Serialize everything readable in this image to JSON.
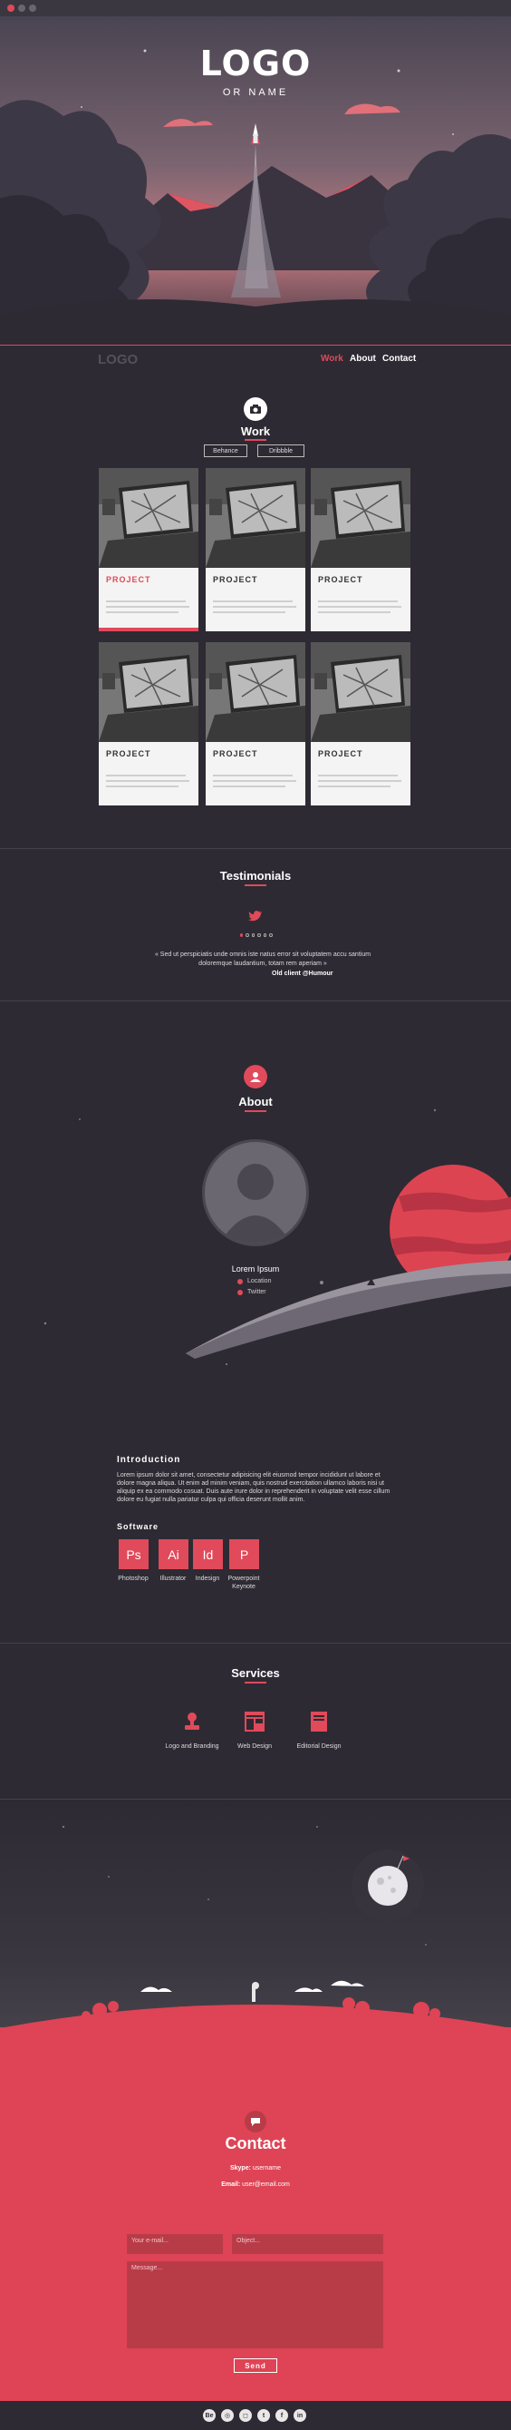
{
  "colors": {
    "accent": "#e04a5a",
    "background": "#2d2a33",
    "contact_bg": "#de4455"
  },
  "hero": {
    "logo": "LOGO",
    "logo_sub": "OR NAME"
  },
  "nav": {
    "logo": "LOGO",
    "items": [
      "Work",
      "About",
      "Contact"
    ],
    "active": "Work"
  },
  "work": {
    "title": "Work",
    "icon": "camera-icon",
    "filters": [
      "Behance",
      "Dribbble"
    ],
    "projects": [
      {
        "title": "PROJECT",
        "highlighted": true
      },
      {
        "title": "PROJECT",
        "highlighted": false
      },
      {
        "title": "PROJECT",
        "highlighted": false
      },
      {
        "title": "PROJECT",
        "highlighted": false
      },
      {
        "title": "PROJECT",
        "highlighted": false
      },
      {
        "title": "PROJECT",
        "highlighted": false
      }
    ]
  },
  "testimonials": {
    "title": "Testimonials",
    "icon": "twitter-icon",
    "quote": "« Sed ut perspiciatis unde omnis iste natus error sit voluptatem accu santium doloremque laudantium, totam rem aperiam »",
    "author": "Old client @Humour"
  },
  "about": {
    "title": "About",
    "icon": "user-icon",
    "name": "Lorem Ipsum",
    "location": "Location",
    "twitter": "Twitter",
    "intro_heading": "Introduction",
    "intro_text": "Lorem ipsum dolor sit amet, consectetur adipisicing elit eiusmod tempor incididunt ut labore et dolore magna aliqua. Ut enim ad minim veniam, quis nostrud exercitation ullamco laboris nisi ut aliquip ex ea commodo cosuat. Duis aute irure dolor in reprehenderit in voluptate velit esse cillum dolore eu fugiat nulla pariatur culpa qui officia deserunt mollit anim.",
    "software_heading": "Software",
    "software": [
      {
        "abbr": "Ps",
        "label": "Photoshop"
      },
      {
        "abbr": "Ai",
        "label": "Illustrator"
      },
      {
        "abbr": "Id",
        "label": "Indesign"
      },
      {
        "abbr": "P",
        "label": "Powerpoint Keynote"
      }
    ]
  },
  "services": {
    "title": "Services",
    "items": [
      {
        "label": "Logo and Branding",
        "icon": "stamp-icon"
      },
      {
        "label": "Web Design",
        "icon": "layout-icon"
      },
      {
        "label": "Editorial Design",
        "icon": "book-icon"
      }
    ]
  },
  "contact": {
    "title": "Contact",
    "icon": "chat-icon",
    "skype_label": "Skype:",
    "skype_value": "username",
    "email_label": "Email:",
    "email_value": "user@email.com",
    "email_placeholder": "Your e-mail...",
    "object_placeholder": "Object...",
    "message_placeholder": "Message...",
    "send_label": "Send"
  },
  "footer": {
    "socials": [
      {
        "icon": "behance-icon",
        "text": "Be"
      },
      {
        "icon": "dribbble-icon",
        "text": "◎"
      },
      {
        "icon": "instagram-icon",
        "text": "◻"
      },
      {
        "icon": "twitter-icon",
        "text": "t"
      },
      {
        "icon": "facebook-icon",
        "text": "f"
      },
      {
        "icon": "linkedin-icon",
        "text": "in"
      }
    ]
  }
}
